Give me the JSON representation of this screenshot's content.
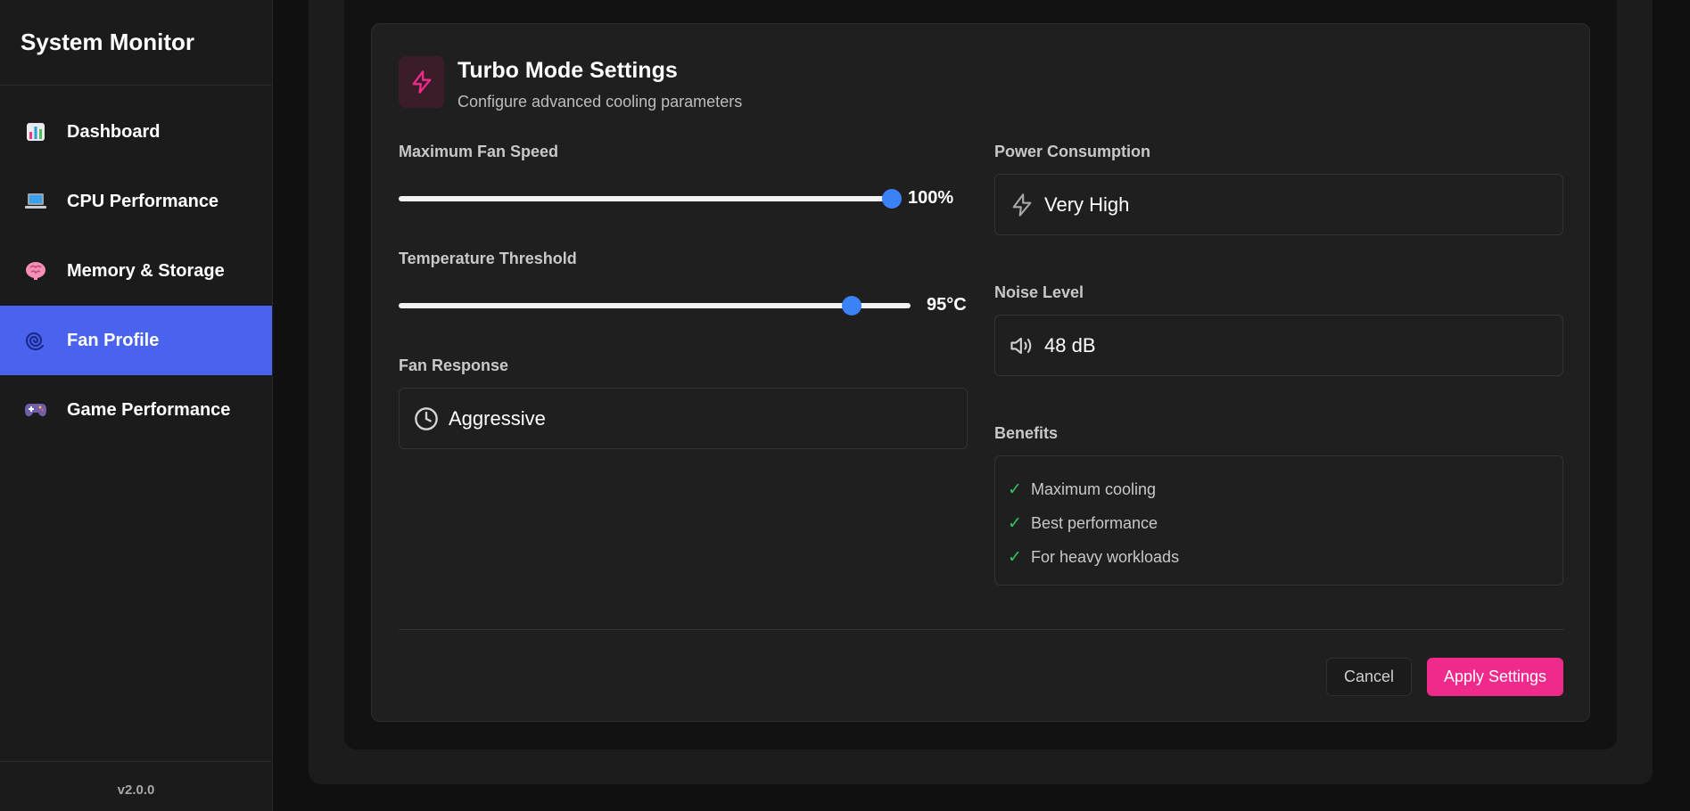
{
  "app": {
    "title": "System Monitor",
    "version": "v2.0.0"
  },
  "sidebar": {
    "items": [
      {
        "label": "Dashboard",
        "icon": "bar-chart-icon",
        "active": false
      },
      {
        "label": "CPU Performance",
        "icon": "laptop-icon",
        "active": false
      },
      {
        "label": "Memory & Storage",
        "icon": "brain-icon",
        "active": false
      },
      {
        "label": "Fan Profile",
        "icon": "cyclone-icon",
        "active": true
      },
      {
        "label": "Game Performance",
        "icon": "gamepad-icon",
        "active": false
      }
    ]
  },
  "card": {
    "title": "Turbo Mode Settings",
    "subtitle": "Configure advanced cooling parameters",
    "icon": "lightning-icon"
  },
  "settings": {
    "max_fan_speed": {
      "label": "Maximum Fan Speed",
      "value_text": "100%",
      "level": 1.0
    },
    "temp_threshold": {
      "label": "Temperature Threshold",
      "value_text": "95°C",
      "level": 0.885
    },
    "fan_response": {
      "label": "Fan Response",
      "value": "Aggressive",
      "icon": "clock-icon"
    },
    "power_consumption": {
      "label": "Power Consumption",
      "value": "Very High",
      "icon": "lightning-icon"
    },
    "noise_level": {
      "label": "Noise Level",
      "value": "48 dB",
      "icon": "speaker-icon"
    },
    "benefits": {
      "label": "Benefits",
      "items": [
        "Maximum cooling",
        "Best performance",
        "For heavy workloads"
      ]
    }
  },
  "actions": {
    "cancel_label": "Cancel",
    "apply_label": "Apply Settings"
  },
  "colors": {
    "accent_blue": "#4a63ee",
    "slider_thumb": "#3b82f6",
    "accent_pink": "#ef2a8a",
    "check_green": "#31c75d"
  }
}
